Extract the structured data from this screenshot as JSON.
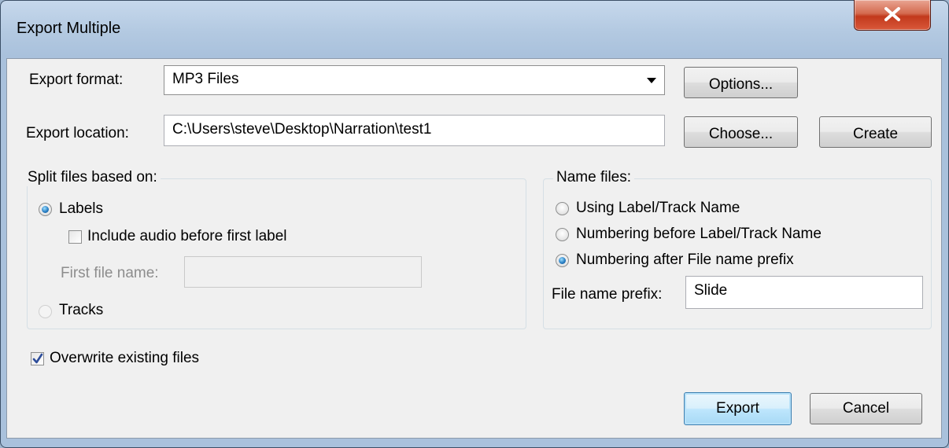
{
  "window": {
    "title": "Export Multiple"
  },
  "format": {
    "label": "Export format:",
    "value": "MP3 Files",
    "options_button": "Options..."
  },
  "location": {
    "label": "Export location:",
    "value": "C:\\Users\\steve\\Desktop\\Narration\\test1",
    "choose_button": "Choose...",
    "create_button": "Create"
  },
  "split": {
    "title": "Split files based on:",
    "labels_option": "Labels",
    "labels_checked": true,
    "include_audio_label": "Include audio before first label",
    "include_audio_checked": false,
    "first_file_label": "First file name:",
    "first_file_value": "",
    "tracks_option": "Tracks",
    "tracks_checked": false
  },
  "name": {
    "title": "Name files:",
    "options": [
      {
        "label": "Using Label/Track Name",
        "checked": false
      },
      {
        "label": "Numbering before Label/Track Name",
        "checked": false
      },
      {
        "label": "Numbering after File name prefix",
        "checked": true
      }
    ],
    "prefix_label": "File name prefix:",
    "prefix_value": "Slide"
  },
  "overwrite": {
    "label": "Overwrite existing files",
    "checked": true
  },
  "buttons": {
    "export": "Export",
    "cancel": "Cancel"
  },
  "icons": {
    "close": "close-icon",
    "dropdown": "chevron-down-icon",
    "check": "checkmark-icon"
  },
  "colors": {
    "accent": "#3c7fb1",
    "close_button": "#c2391c"
  }
}
